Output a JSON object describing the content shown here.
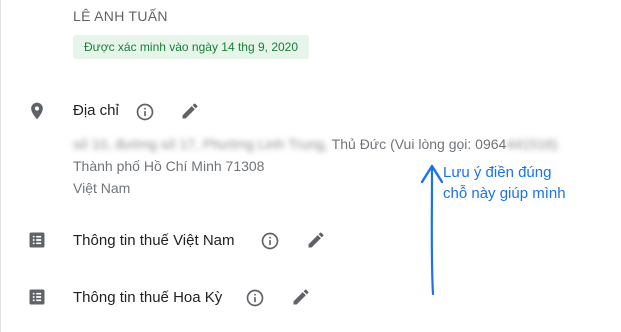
{
  "profile": {
    "owner_name": "LÊ ANH TUẤN",
    "verified_label": "Được xác minh vào ngày 14 thg 9, 2020"
  },
  "address": {
    "label": "Địa chỉ",
    "icon": "location-pin-icon",
    "line1_blurred_prefix": "số 10, đường số 17, Phường Linh Trung,",
    "line1_visible": " Thủ Đức (Vui lòng gọi: 0964",
    "line1_blurred_suffix": "441516)",
    "line2": "Thành phố Hồ Chí Minh 71308",
    "line3": "Việt Nam"
  },
  "tax_vn": {
    "label": "Thông tin thuế Việt Nam",
    "icon": "list-icon"
  },
  "tax_us": {
    "label": "Thông tin thuế Hoa Kỳ",
    "icon": "list-icon"
  },
  "annotation": {
    "line1": "Lưu ý điền đúng",
    "line2": "chỗ này giúp mình",
    "color": "#1a73e8"
  },
  "colors": {
    "verified_bg": "#e6f4ea",
    "verified_text": "#188038",
    "icon_gray": "#5f6368"
  }
}
